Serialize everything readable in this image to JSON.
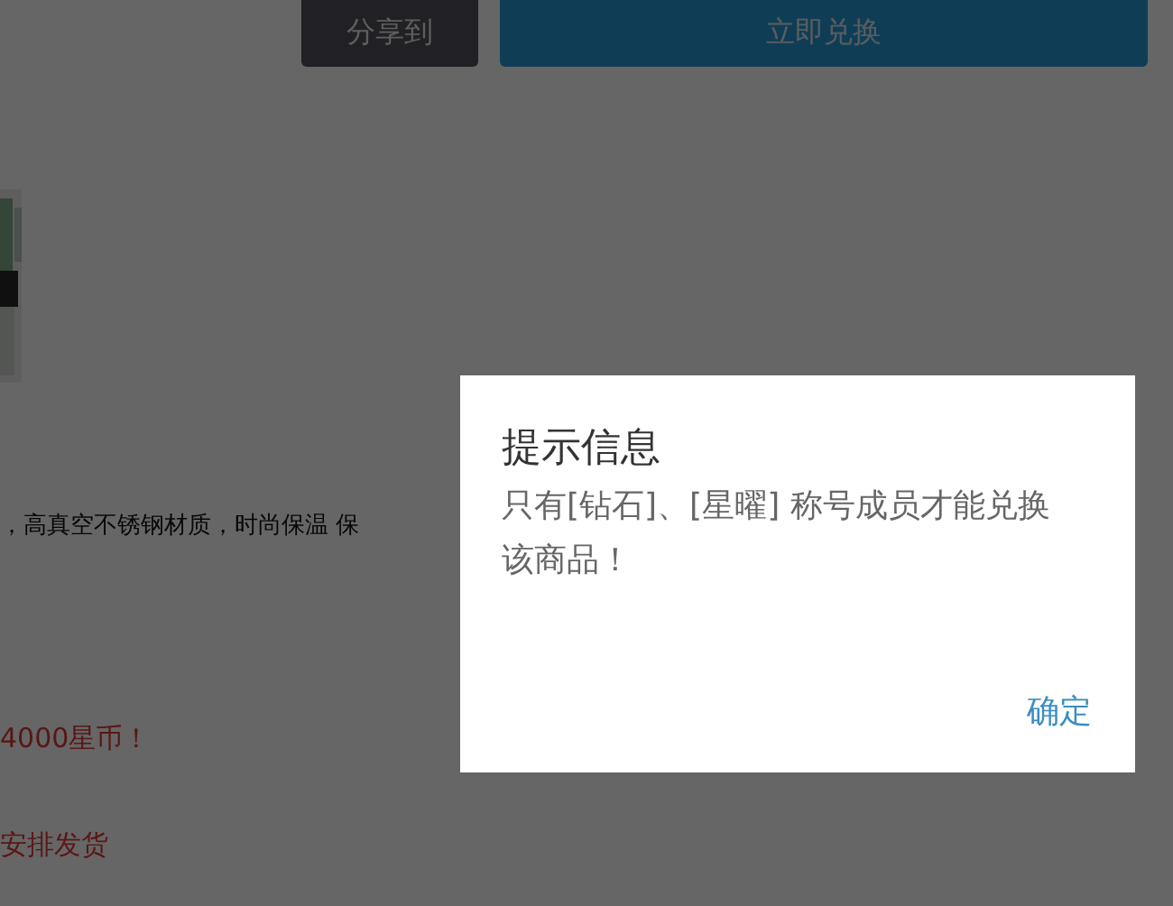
{
  "page": {
    "buttons": [
      {
        "label": "分享到",
        "kind": "share"
      },
      {
        "label": "立即兑换",
        "kind": "redeem"
      }
    ],
    "description": "，高真空不锈钢材质，时尚保温 保",
    "notes": [
      "4000星币！",
      "安排发货"
    ]
  },
  "dialog": {
    "title": "提示信息",
    "message": "只有[钻石]、[星曜] 称号成员才能兑换该商品！",
    "buttons": [
      "确定"
    ]
  }
}
